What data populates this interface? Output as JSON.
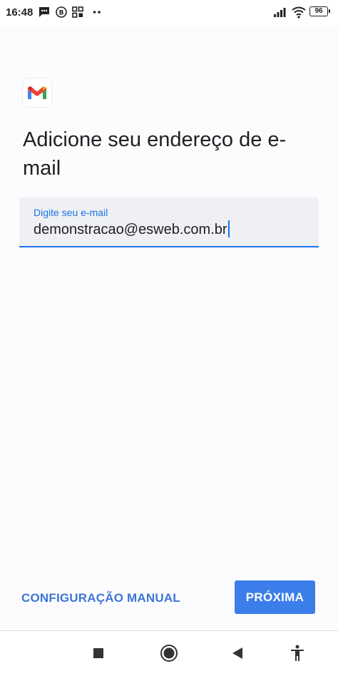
{
  "status_bar": {
    "time": "16:48",
    "battery_level": "96",
    "left_icons": [
      "message-icon",
      "b-circle-icon",
      "grid-apps-icon",
      "more-dots-icon"
    ],
    "right_icons": [
      "signal-icon",
      "wifi-icon",
      "battery-icon"
    ]
  },
  "page": {
    "logo_icon": "gmail-logo-icon",
    "title": "Adicione seu endereço de e-mail",
    "email_field": {
      "label": "Digite seu e-mail",
      "value": "demonstracao@esweb.com.br"
    }
  },
  "footer": {
    "manual_label": "CONFIGURAÇÃO MANUAL",
    "next_label": "PRÓXIMA"
  },
  "nav_bar": {
    "icons": [
      "recents-square-icon",
      "home-circle-icon",
      "back-triangle-icon",
      "accessibility-icon"
    ]
  },
  "colors": {
    "accent": "#1a73e8",
    "button": "#3c7ee9",
    "link": "#3c75d6",
    "field_background": "#eef0f3",
    "title_text": "#202124"
  }
}
